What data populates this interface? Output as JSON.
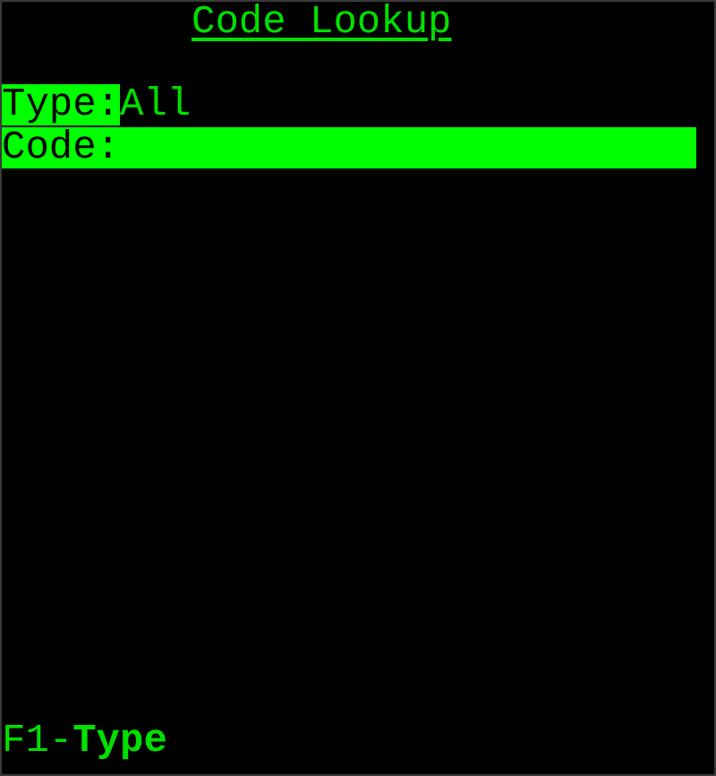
{
  "title": "Code Lookup",
  "fields": [
    {
      "label": "Type:",
      "kind": "display",
      "value": "All"
    },
    {
      "label": "Code:",
      "kind": "input"
    }
  ],
  "footer": "F1-**Type**"
}
